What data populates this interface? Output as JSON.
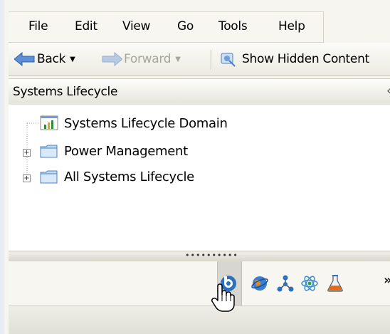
{
  "menu": {
    "items": [
      {
        "label": "File"
      },
      {
        "label": "Edit"
      },
      {
        "label": "View"
      },
      {
        "label": "Go"
      },
      {
        "label": "Tools"
      },
      {
        "label": "Help"
      }
    ]
  },
  "toolbar": {
    "back_label": "Back",
    "forward_label": "Forward",
    "show_hidden_label": "Show Hidden Content"
  },
  "panel": {
    "title": "Systems Lifecycle",
    "collapse_glyph": "«"
  },
  "tree": {
    "items": [
      {
        "label": "Systems Lifecycle Domain",
        "icon": "domain-chart-icon",
        "expandable": false
      },
      {
        "label": "Power Management",
        "icon": "folder-icon",
        "expandable": true
      },
      {
        "label": "All Systems Lifecycle",
        "icon": "folder-icon",
        "expandable": true
      }
    ]
  },
  "shortcuts": {
    "icons": [
      "systems-lifecycle-icon",
      "globe-icon",
      "topology-icon",
      "atom-icon",
      "flask-icon"
    ],
    "overflow_glyph": "»"
  },
  "colors": {
    "accent": "#2d6fc0",
    "active_button": "#d7d6d1"
  }
}
